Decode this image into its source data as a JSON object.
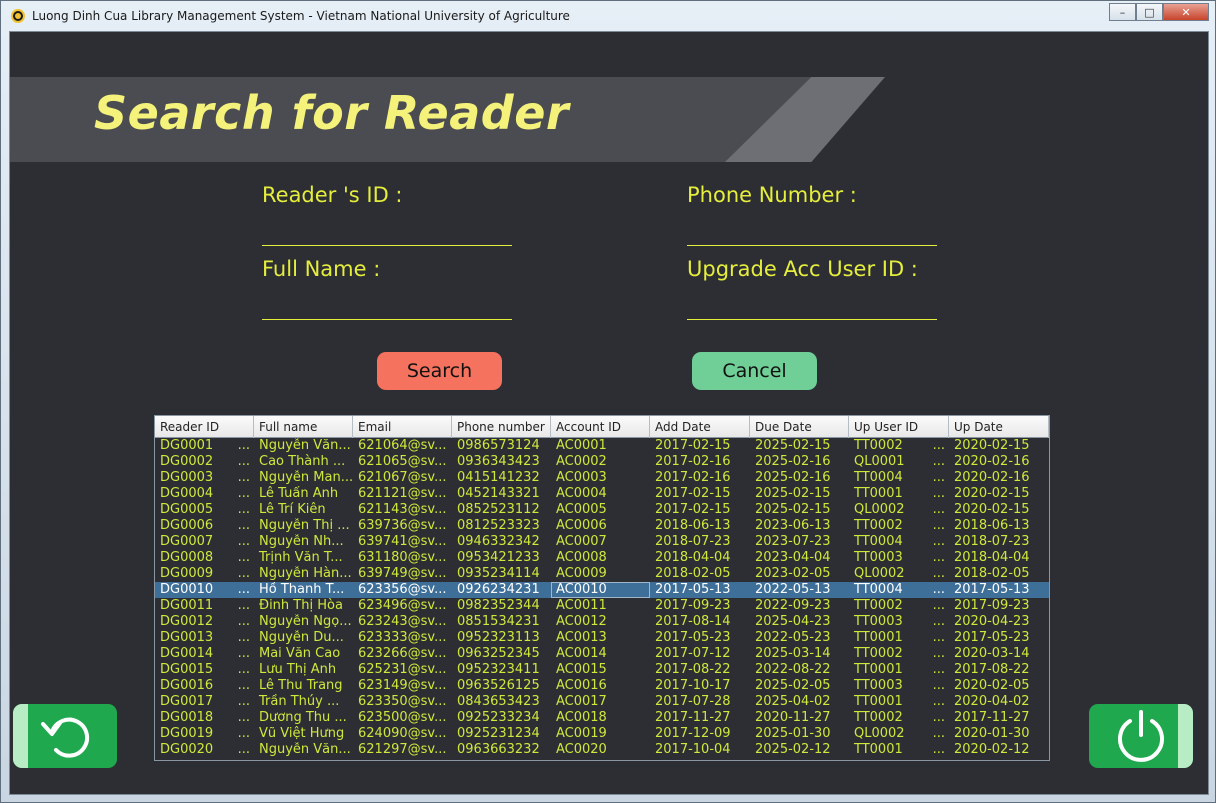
{
  "window": {
    "title": "Luong Dinh Cua Library Management System - Vietnam National University of Agriculture",
    "minimize": "–",
    "maximize": "□",
    "close": "✕"
  },
  "header": {
    "title": "Search for Reader"
  },
  "form": {
    "reader_id_label": "Reader 's ID :",
    "phone_label": "Phone Number :",
    "full_name_label": "Full Name :",
    "upgrade_label": "Upgrade Acc User ID :",
    "reader_id_value": "",
    "phone_value": "",
    "full_name_value": "",
    "upgrade_value": ""
  },
  "buttons": {
    "search": "Search",
    "cancel": "Cancel"
  },
  "table": {
    "columns": [
      "Reader ID",
      "Full name",
      "Email",
      "Phone number",
      "Account ID",
      "Add Date",
      "Due Date",
      "Up User ID",
      "Up Date"
    ],
    "selected_row": 9,
    "rows": [
      [
        "DG0001",
        "Nguyễn Văn...",
        "621064@sv...",
        "0986573124",
        "AC0001",
        "2017-02-15",
        "2025-02-15",
        "TT0002",
        "2020-02-15"
      ],
      [
        "DG0002",
        "Cao Thành ...",
        "621065@sv...",
        "0936343423",
        "AC0002",
        "2017-02-16",
        "2025-02-16",
        "QL0001",
        "2020-02-16"
      ],
      [
        "DG0003",
        "Nguyễn Man...",
        "621067@sv...",
        "0415141232",
        "AC0003",
        "2017-02-16",
        "2025-02-16",
        "TT0004",
        "2020-02-16"
      ],
      [
        "DG0004",
        "Lê Tuấn Anh",
        "621121@sv...",
        "0452143321",
        "AC0004",
        "2017-02-15",
        "2025-02-15",
        "TT0001",
        "2020-02-15"
      ],
      [
        "DG0005",
        "Lê Trí Kiên",
        "621143@sv...",
        "0852523112",
        "AC0005",
        "2017-02-15",
        "2025-02-15",
        "QL0002",
        "2020-02-15"
      ],
      [
        "DG0006",
        "Nguyễn Thị ...",
        "639736@sv...",
        "0812523323",
        "AC0006",
        "2018-06-13",
        "2023-06-13",
        "TT0002",
        "2018-06-13"
      ],
      [
        "DG0007",
        "Nguyễn Nh...",
        "639741@sv...",
        "0946332342",
        "AC0007",
        "2018-07-23",
        "2023-07-23",
        "TT0004",
        "2018-07-23"
      ],
      [
        "DG0008",
        "Trịnh Văn T...",
        "631180@sv...",
        "0953421233",
        "AC0008",
        "2018-04-04",
        "2023-04-04",
        "TT0003",
        "2018-04-04"
      ],
      [
        "DG0009",
        "Nguyễn Hàn...",
        "639749@sv...",
        "0935234114",
        "AC0009",
        "2018-02-05",
        "2023-02-05",
        "QL0002",
        "2018-02-05"
      ],
      [
        "DG0010",
        "Hồ Thanh T...",
        "623356@sv...",
        "0926234231",
        "AC0010",
        "2017-05-13",
        "2022-05-13",
        "TT0004",
        "2017-05-13"
      ],
      [
        "DG0011",
        "Đinh Thị Hòa",
        "623496@sv...",
        "0982352344",
        "AC0011",
        "2017-09-23",
        "2022-09-23",
        "TT0002",
        "2017-09-23"
      ],
      [
        "DG0012",
        "Nguyễn Ngọ...",
        "623243@sv...",
        "0851534231",
        "AC0012",
        "2017-08-14",
        "2025-04-23",
        "TT0003",
        "2020-04-23"
      ],
      [
        "DG0013",
        "Nguyễn Du...",
        "623333@sv...",
        "0952323113",
        "AC0013",
        "2017-05-23",
        "2022-05-23",
        "TT0001",
        "2017-05-23"
      ],
      [
        "DG0014",
        "Mai Văn Cao",
        "623266@sv...",
        "0963252345",
        "AC0014",
        "2017-07-12",
        "2025-03-14",
        "TT0002",
        "2020-03-14"
      ],
      [
        "DG0015",
        "Lưu Thị Anh",
        "625231@sv...",
        "0952323411",
        "AC0015",
        "2017-08-22",
        "2022-08-22",
        "TT0001",
        "2017-08-22"
      ],
      [
        "DG0016",
        "Lê Thu Trang",
        "623149@sv...",
        "0963526125",
        "AC0016",
        "2017-10-17",
        "2025-02-05",
        "TT0003",
        "2020-02-05"
      ],
      [
        "DG0017",
        "Trần Thúy ...",
        "623350@sv...",
        "0843653423",
        "AC0017",
        "2017-07-28",
        "2025-04-02",
        "TT0001",
        "2020-04-02"
      ],
      [
        "DG0018",
        "Dương Thu ...",
        "623500@sv...",
        "0925233234",
        "AC0018",
        "2017-11-27",
        "2020-11-27",
        "TT0002",
        "2017-11-27"
      ],
      [
        "DG0019",
        "Vũ Việt Hưng",
        "624090@sv...",
        "0925231234",
        "AC0019",
        "2017-12-09",
        "2025-01-30",
        "QL0002",
        "2020-01-30"
      ],
      [
        "DG0020",
        "Nguyễn Văn...",
        "621297@sv...",
        "0963663232",
        "AC0020",
        "2017-10-04",
        "2025-02-12",
        "TT0001",
        "2020-02-12"
      ]
    ]
  },
  "side_buttons": {
    "left_icon": "refresh-icon",
    "right_icon": "power-icon"
  },
  "colors": {
    "accent_text": "#e6ee3c",
    "table_text": "#cfe83b",
    "search_btn": "#f4725e",
    "cancel_btn": "#6fcf97",
    "side_btn": "#1fa84d",
    "background": "#2c2e34"
  }
}
